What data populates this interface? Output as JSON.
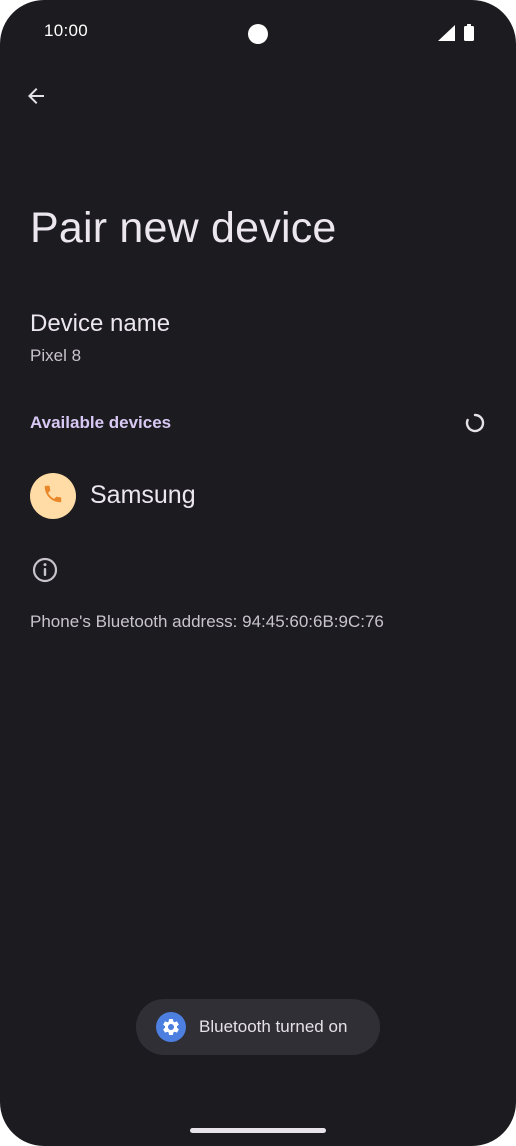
{
  "status_bar": {
    "time": "10:00",
    "icons": [
      "signal-icon",
      "battery-icon"
    ]
  },
  "app_bar": {
    "back_icon": "arrow-back-icon"
  },
  "page": {
    "title": "Pair new device"
  },
  "device_name": {
    "title": "Device name",
    "value": "Pixel 8"
  },
  "available_devices": {
    "header": "Available devices",
    "progress_icon": "spinner-icon",
    "items": [
      {
        "label": "Samsung",
        "icon": "phone-icon",
        "avatar_color": "#ffdca6",
        "icon_color": "#e8872a"
      }
    ]
  },
  "footer": {
    "info_icon": "info-icon",
    "address_text": "Phone's Bluetooth address: 94:45:60:6B:9C:76"
  },
  "toast": {
    "icon": "settings-gear-icon",
    "text": "Bluetooth turned on"
  },
  "colors": {
    "background": "#1c1b20",
    "accent": "#d8c9f4",
    "toast_background": "#302f35",
    "toast_icon": "#4d7fe0"
  }
}
